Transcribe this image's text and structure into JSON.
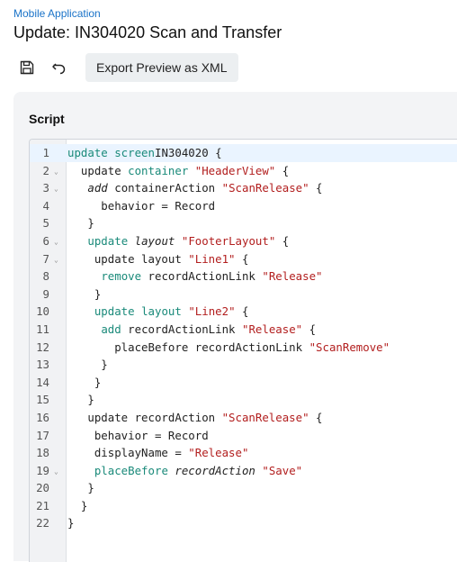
{
  "header": {
    "breadcrumb": "Mobile Application",
    "title": "Update: IN304020 Scan and Transfer"
  },
  "toolbar": {
    "save_icon": "save-icon",
    "undo_icon": "undo-icon",
    "export_label": "Export Preview as XML"
  },
  "script": {
    "section_title": "Script",
    "lines": [
      {
        "n": "1",
        "fold": false,
        "active": true,
        "tokens": [
          [
            "kw",
            "update screen"
          ],
          [
            "",
            "IN304020 {"
          ]
        ]
      },
      {
        "n": "2",
        "fold": true,
        "tokens": [
          [
            "",
            "  "
          ],
          [
            "",
            "update "
          ],
          [
            "kw",
            "container"
          ],
          [
            "",
            ""
          ],
          [
            "str",
            " \"HeaderView\""
          ],
          [
            "",
            " {"
          ]
        ]
      },
      {
        "n": "3",
        "fold": true,
        "tokens": [
          [
            "",
            "   "
          ],
          [
            "ital",
            "add"
          ],
          [
            "",
            " containerAction "
          ],
          [
            "str",
            "\"ScanRelease\""
          ],
          [
            "",
            " {"
          ]
        ]
      },
      {
        "n": "4",
        "fold": false,
        "tokens": [
          [
            "",
            "     behavior = Record"
          ]
        ]
      },
      {
        "n": "5",
        "fold": false,
        "tokens": [
          [
            "",
            "   }"
          ]
        ]
      },
      {
        "n": "6",
        "fold": true,
        "tokens": [
          [
            "",
            "   "
          ],
          [
            "kw",
            "update"
          ],
          [
            "",
            " "
          ],
          [
            "ital",
            "layout"
          ],
          [
            "",
            " "
          ],
          [
            "str",
            "\"FooterLayout\""
          ],
          [
            "",
            " {"
          ]
        ]
      },
      {
        "n": "7",
        "fold": true,
        "tokens": [
          [
            "",
            "    update layout "
          ],
          [
            "str",
            "\"Line1\""
          ],
          [
            "",
            " {"
          ]
        ]
      },
      {
        "n": "8",
        "fold": false,
        "tokens": [
          [
            "",
            "     "
          ],
          [
            "kw",
            "remove"
          ],
          [
            "",
            " recordActionLink "
          ],
          [
            "str",
            "\"Release\""
          ]
        ]
      },
      {
        "n": "9",
        "fold": false,
        "tokens": [
          [
            "",
            "    }"
          ]
        ]
      },
      {
        "n": "10",
        "fold": false,
        "tokens": [
          [
            "",
            "    "
          ],
          [
            "kw",
            "update"
          ],
          [
            "",
            " "
          ],
          [
            "kw",
            "layout"
          ],
          [
            "",
            " "
          ],
          [
            "str",
            "\"Line2\""
          ],
          [
            "",
            " {"
          ]
        ]
      },
      {
        "n": "11",
        "fold": false,
        "tokens": [
          [
            "",
            "     "
          ],
          [
            "kw",
            "add"
          ],
          [
            "",
            " recordActionLink "
          ],
          [
            "str",
            "\"Release\""
          ],
          [
            "",
            " {"
          ]
        ]
      },
      {
        "n": "12",
        "fold": false,
        "tokens": [
          [
            "",
            "       placeBefore recordActionLink "
          ],
          [
            "str",
            "\"ScanRemove\""
          ]
        ]
      },
      {
        "n": "13",
        "fold": false,
        "tokens": [
          [
            "",
            "     }"
          ]
        ]
      },
      {
        "n": "14",
        "fold": false,
        "tokens": [
          [
            "",
            "    }"
          ]
        ]
      },
      {
        "n": "15",
        "fold": false,
        "tokens": [
          [
            "",
            "   }"
          ]
        ]
      },
      {
        "n": "16",
        "fold": false,
        "tokens": [
          [
            "",
            "   update recordAction "
          ],
          [
            "str",
            "\"ScanRelease\""
          ],
          [
            "",
            " {"
          ]
        ]
      },
      {
        "n": "17",
        "fold": false,
        "tokens": [
          [
            "",
            "    behavior = Record"
          ]
        ]
      },
      {
        "n": "18",
        "fold": false,
        "tokens": [
          [
            "",
            "    displayName = "
          ],
          [
            "str",
            "\"Release\""
          ]
        ]
      },
      {
        "n": "19",
        "fold": true,
        "tokens": [
          [
            "",
            "    "
          ],
          [
            "kw",
            "placeBefore"
          ],
          [
            "",
            " "
          ],
          [
            "ital",
            "recordAction"
          ],
          [
            "",
            " "
          ],
          [
            "str",
            "\"Save\""
          ]
        ]
      },
      {
        "n": "20",
        "fold": false,
        "tokens": [
          [
            "",
            "   }"
          ]
        ]
      },
      {
        "n": "21",
        "fold": false,
        "tokens": [
          [
            "",
            "  }"
          ]
        ]
      },
      {
        "n": "22",
        "fold": false,
        "tokens": [
          [
            "",
            "}"
          ]
        ]
      }
    ]
  }
}
